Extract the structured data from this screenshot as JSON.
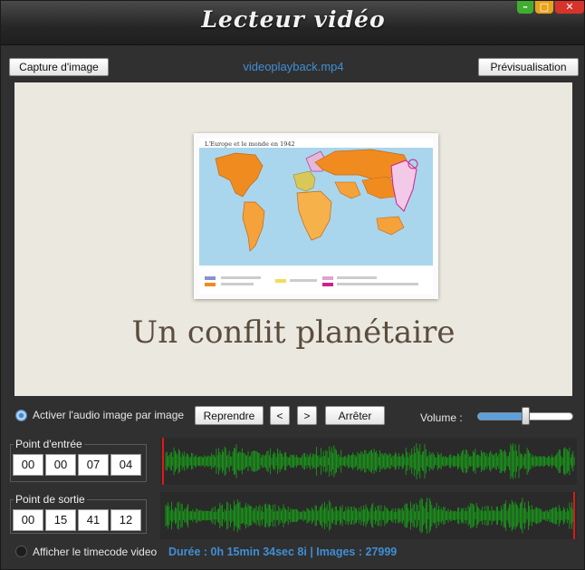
{
  "window": {
    "title": "Lecteur vidéo",
    "controls": {
      "minimize": "–",
      "maximize": "□",
      "close": "✕"
    }
  },
  "toolbar": {
    "capture_label": "Capture d'image",
    "filename": "videoplayback.mp4",
    "preview_label": "Prévisualisation"
  },
  "video": {
    "slide_text": "Un conflit planétaire",
    "map_title": "L'Europe et le monde en 1942"
  },
  "controls": {
    "audio_frame_label": "Activer l'audio image par image",
    "audio_frame_checked": true,
    "resume_label": "Reprendre",
    "prev_label": "<",
    "next_label": ">",
    "stop_label": "Arrêter",
    "volume_label": "Volume :",
    "volume_level": 0.5
  },
  "in_point": {
    "title": "Point d'entrée",
    "fields": [
      "00",
      "00",
      "07",
      "04"
    ],
    "marker_position": 0.0
  },
  "out_point": {
    "title": "Point de sortie",
    "fields": [
      "00",
      "15",
      "41",
      "12"
    ],
    "marker_position": 1.0
  },
  "footer": {
    "timecode_label": "Afficher le timecode video",
    "timecode_checked": false,
    "status": "Durée : 0h 15min 34sec 8i | Images : 27999"
  },
  "colors": {
    "accent": "#3f8fd4",
    "waveform": "#17a817",
    "marker": "#e01818",
    "background": "#303030"
  }
}
